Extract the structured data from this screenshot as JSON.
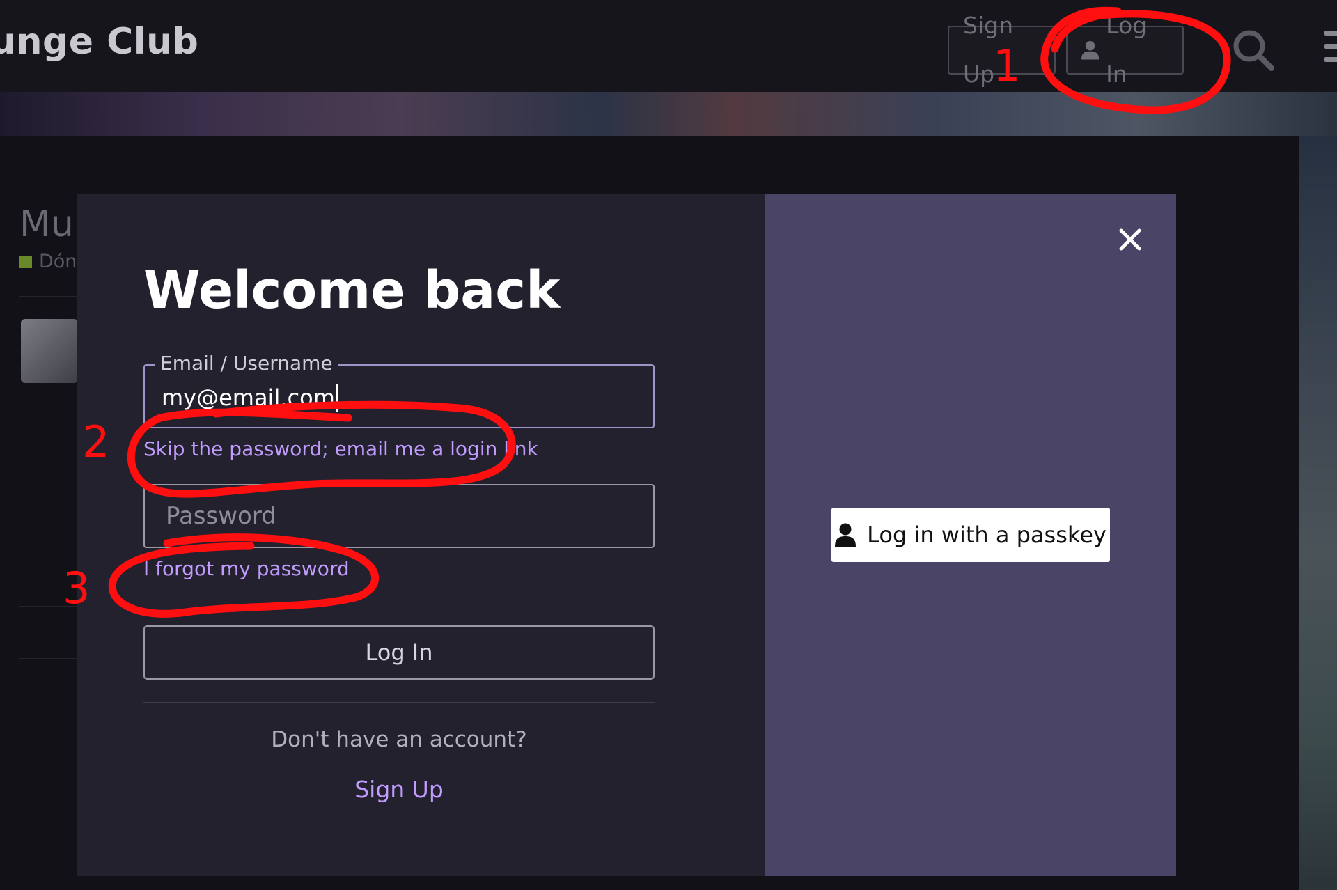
{
  "header": {
    "site_title": "unge Club",
    "signup_label": "Sign Up",
    "login_label": "Log In"
  },
  "background": {
    "topic_title": "Mu",
    "category": "Dón"
  },
  "modal": {
    "title": "Welcome back",
    "email_label": "Email / Username",
    "email_value": "my@email.com",
    "email_login_link": "Skip the password; email me a login link",
    "password_placeholder": "Password",
    "forgot_link": "I forgot my password",
    "login_button": "Log In",
    "no_account_text": "Don't have an account?",
    "signup_link": "Sign Up",
    "passkey_button": "Log in with a passkey"
  },
  "annotations": {
    "marker_1": "1",
    "marker_2": "2",
    "marker_3": "3"
  },
  "colors": {
    "accent_link": "#c29bff",
    "modal_left_bg": "#23212e",
    "modal_right_bg": "#4a4466",
    "annotation_red": "#ff0f0f"
  }
}
